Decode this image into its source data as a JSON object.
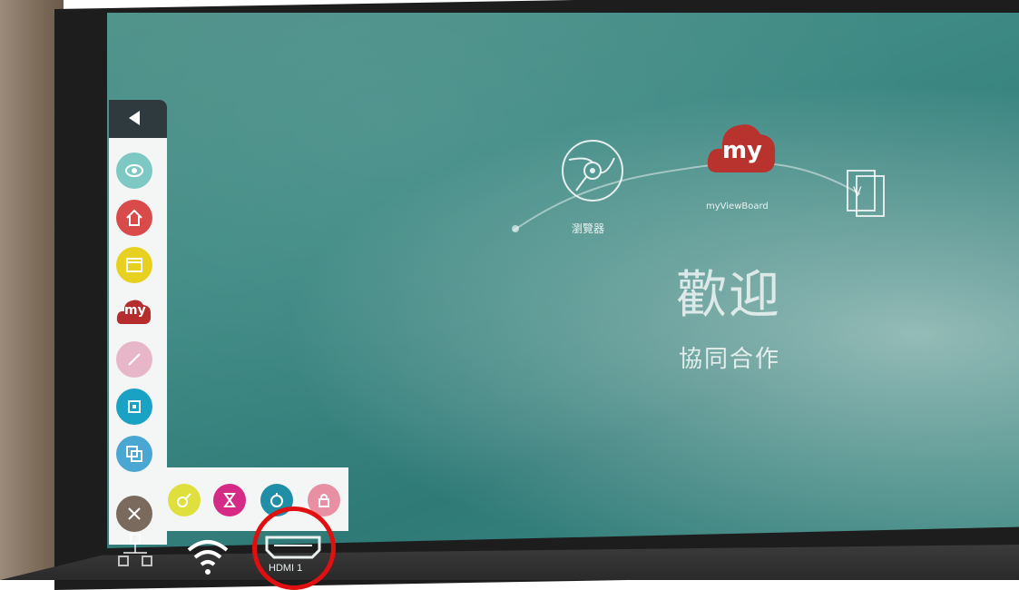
{
  "sidebar": {
    "collapse_icon": "chevron-left-icon",
    "items": [
      {
        "name": "eye",
        "icon": "eye-icon",
        "color": "#7ec8c4"
      },
      {
        "name": "home",
        "icon": "home-icon",
        "color": "#d94a4a"
      },
      {
        "name": "windows",
        "icon": "windows-icon",
        "color": "#e8d021"
      },
      {
        "name": "myviewboard",
        "label": "my",
        "icon": "my-cloud-icon",
        "color": "#b52d2d"
      },
      {
        "name": "pen",
        "icon": "pen-icon",
        "color": "#e7b6c8"
      },
      {
        "name": "screenshot",
        "icon": "crop-icon",
        "color": "#1aa2c4"
      },
      {
        "name": "multi-window",
        "icon": "overlap-icon",
        "color": "#4aa7d1"
      },
      {
        "name": "tools",
        "icon": "tools-icon",
        "color": "#7a6a5e"
      }
    ]
  },
  "tray": {
    "items": [
      {
        "name": "spotlight",
        "icon": "spotlight-icon",
        "color": "#dfe03d"
      },
      {
        "name": "timer",
        "icon": "hourglass-icon",
        "color": "#d52b86"
      },
      {
        "name": "stopwatch",
        "icon": "stopwatch-icon",
        "color": "#1f8ea6"
      },
      {
        "name": "lock",
        "icon": "lock-icon",
        "color": "#e98fa3"
      }
    ]
  },
  "status_bar": {
    "network_icon": "network-icon",
    "wifi_icon": "wifi-icon",
    "hdmi_icon": "hdmi-icon",
    "hdmi_label": "HDMI 1"
  },
  "home": {
    "apps": [
      {
        "name": "browser",
        "label": "瀏覽器",
        "icon": "browser-icon"
      },
      {
        "name": "myviewboard",
        "label": "myViewBoard",
        "icon": "my-cloud-icon"
      },
      {
        "name": "vplayer",
        "icon": "document-icon"
      }
    ],
    "welcome_title": "歡迎",
    "welcome_subtitle": "協同合作"
  },
  "colors": {
    "screen": "#3f8a84",
    "highlight_circle": "#e01010",
    "sidebar_head": "#2e3a3e"
  }
}
